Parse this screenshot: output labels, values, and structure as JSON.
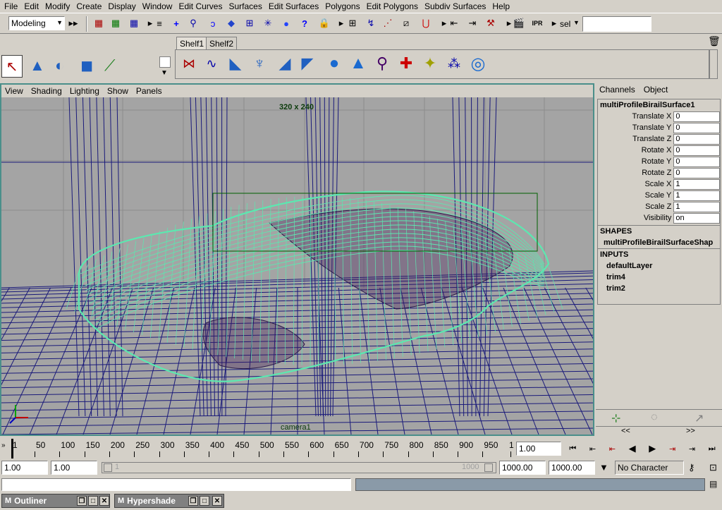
{
  "menubar": [
    "File",
    "Edit",
    "Modify",
    "Create",
    "Display",
    "Window",
    "Edit Curves",
    "Surfaces",
    "Edit Surfaces",
    "Polygons",
    "Edit Polygons",
    "Subdiv Surfaces",
    "Help"
  ],
  "status": {
    "mode": "Modeling",
    "sel_label": "sel",
    "input_value": ""
  },
  "shelf": {
    "tabs": [
      "Shelf1",
      "Shelf2"
    ]
  },
  "viewport": {
    "menu": [
      "View",
      "Shading",
      "Lighting",
      "Show",
      "Panels"
    ],
    "resolution": "320 x 240",
    "camera": "camera1",
    "colors": {
      "grid": "#1a1a7a",
      "wire": "#5ce8b0",
      "bg": "#a4a4a4"
    }
  },
  "channelbox": {
    "menu": [
      "Channels",
      "Object"
    ],
    "object": "multiProfileBirailSurface1",
    "attrs": [
      {
        "label": "Translate X",
        "value": "0"
      },
      {
        "label": "Translate Y",
        "value": "0"
      },
      {
        "label": "Translate Z",
        "value": "0"
      },
      {
        "label": "Rotate X",
        "value": "0"
      },
      {
        "label": "Rotate Y",
        "value": "0"
      },
      {
        "label": "Rotate Z",
        "value": "0"
      },
      {
        "label": "Scale X",
        "value": "1"
      },
      {
        "label": "Scale Y",
        "value": "1"
      },
      {
        "label": "Scale Z",
        "value": "1"
      },
      {
        "label": "Visibility",
        "value": "on"
      }
    ],
    "shapes_label": "SHAPES",
    "shape": "multiProfileBirailSurfaceShap",
    "inputs_label": "INPUTS",
    "inputs": [
      "defaultLayer",
      "trim4",
      "trim2"
    ],
    "nav_left": "<<",
    "nav_right": ">>"
  },
  "timeslider": {
    "ticks": [
      "1",
      "50",
      "100",
      "150",
      "200",
      "250",
      "300",
      "350",
      "400",
      "450",
      "500",
      "550",
      "600",
      "650",
      "700",
      "750",
      "800",
      "850",
      "900",
      "950",
      "1"
    ],
    "current": "1.00"
  },
  "range": {
    "start": "1.00",
    "playback_start": "1.00",
    "left_marker": "1",
    "right_marker": "1000",
    "playback_end": "1000.00",
    "end": "1000.00",
    "character": "No Character"
  },
  "taskbar": [
    "Outliner",
    "Hypershade"
  ]
}
